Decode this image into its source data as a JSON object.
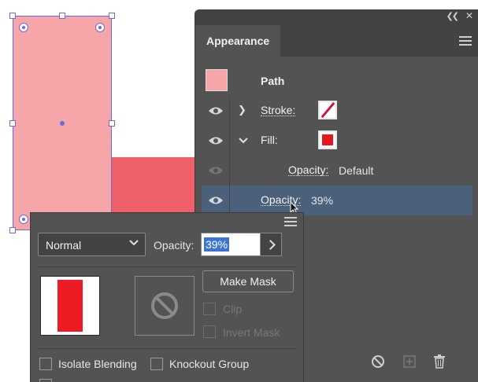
{
  "appearance": {
    "tab_title": "Appearance",
    "rows": [
      {
        "label": "Path"
      },
      {
        "label": "Stroke:"
      },
      {
        "label": "Fill:"
      },
      {
        "label": "Opacity:",
        "value": "Default"
      },
      {
        "label": "Opacity:",
        "value": "39%"
      }
    ],
    "colors": {
      "path_thumb": "#f6a5a8",
      "fill_swatch": "#e8151f",
      "stroke_swatch": "#d3143a",
      "selected_row": "#4b607a"
    }
  },
  "transparency": {
    "blend_mode": "Normal",
    "opacity_label": "Opacity:",
    "opacity_value": "39%",
    "make_mask_label": "Make Mask",
    "clip_label": "Clip",
    "invert_mask_label": "Invert Mask",
    "isolate_blending_label": "Isolate Blending",
    "knockout_group_label": "Knockout Group"
  },
  "canvas": {
    "colors": {
      "pink_rect": "#f6a5a8",
      "red_rect": "#ef4048",
      "selection": "#6f6ad8"
    }
  }
}
